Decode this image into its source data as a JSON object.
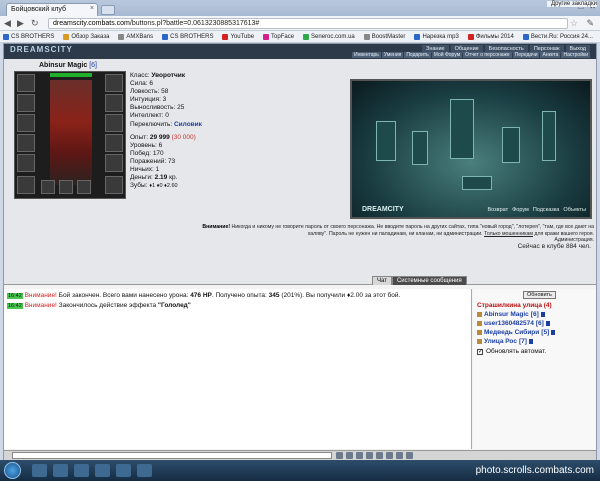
{
  "browser": {
    "tab_title": "Бойцовский клуб",
    "tab_close": "×",
    "url_host": "dreamscity.combats.com",
    "url_path": "/buttons.pl?battle=0.0613230885317613#",
    "back_glyph": "◀",
    "forward_glyph": "▶",
    "reload_glyph": "↻",
    "star_glyph": "☆",
    "menu_glyph": "✎",
    "window_controls": [
      "—",
      "□",
      "✕"
    ]
  },
  "bookmarks": [
    {
      "label": "CS BROTHERS",
      "color": "#2b66c8"
    },
    {
      "label": "Обзор Заказа",
      "color": "#d79b26"
    },
    {
      "label": "AMXBans",
      "color": "#888888"
    },
    {
      "label": "CS BROTHERS",
      "color": "#2b66c8"
    },
    {
      "label": "YouTube",
      "color": "#d32222"
    },
    {
      "label": "TopFace",
      "color": "#d3228d"
    },
    {
      "label": "Seneroc.com.ua",
      "color": "#2fa84a"
    },
    {
      "label": "BoostMaster",
      "color": "#888888"
    },
    {
      "label": "Нарезка mp3",
      "color": "#2b66c8"
    },
    {
      "label": "Фильмы 2014",
      "color": "#d32222"
    },
    {
      "label": "Вести.Ru: Россия 24...",
      "color": "#2b66c8"
    }
  ],
  "bookmarks_other": "Другие закладки",
  "game": {
    "logo": "DREAMSCITY",
    "top_nav": [
      "Знание",
      "Общение",
      "Безопасность",
      "Персонаж",
      "Выход"
    ],
    "sub_nav": [
      "Инвентарь",
      "Умения",
      "Подарить",
      "Мой Форум",
      "Отчет о персонаже",
      "Передачи",
      "Анкета",
      "Настройки"
    ],
    "character": {
      "name": "Abinsur Magic",
      "level": "[6]"
    },
    "stats": {
      "class_label": "Класс:",
      "class_value": "Уворотчик",
      "str": "Сила: 6",
      "agi": "Ловкость: 58",
      "int": "Интуиция: 3",
      "end": "Выносливость: 25",
      "intel": "Интеллект: 0",
      "switch_label": "Переключить:",
      "switch_value": "Силовик",
      "exp_label": "Опыт:",
      "exp_value": "29 999",
      "exp_next": "(30 000)",
      "level": "Уровень: 6",
      "wins": "Побед: 170",
      "losses": "Поражений: 73",
      "draws": "Ничьих: 1",
      "money_label": "Деньги:",
      "money_value": "2.19",
      "money_unit": "кр.",
      "teeth_label": "Зубы:",
      "teeth_value": "♦1 ♦0 ♦2.60"
    },
    "scene": {
      "logo": "DREAMCITY",
      "links": [
        "Возврат",
        "Форум",
        "Подсказка",
        "Объекты"
      ]
    },
    "warning": {
      "title": "Внимание!",
      "text": "Никогда и никому не говорите пароль от своего персонажа. Не вводите пароль на других сайтах, типа \"новый город\", \"лотерея\", \"там, где все дают на халяву\". Пароль не нужен ни паладинам, ни кланам, ни администрации.",
      "link": "Только мошенникам",
      "tail": "для кражи вашего героя.",
      "sign": "Администрация."
    },
    "online": "Сейчас в клубе 884 чел."
  },
  "chat": {
    "tabs": [
      "Чат",
      "Системные сообщения"
    ],
    "messages": [
      {
        "time": "16:42",
        "warn": "Внимание!",
        "pre": "Бой закончен. Всего вами нанесено урона:",
        "dmg": "476 HP",
        "mid": ". Получено опыта:",
        "exp": "345",
        "post": "(201%). Вы получили ♦2.00 за этот бой."
      },
      {
        "time": "16:42",
        "warn": "Внимание!",
        "pre": "Закончилось действие эффекта",
        "effect": "\"Гололед\""
      }
    ]
  },
  "side": {
    "refresh": "Обновить",
    "location": "Страшилкина улица (4)",
    "users": [
      {
        "name": "Abinsur Magic",
        "level": "[6]"
      },
      {
        "name": "user1360482574",
        "level": "[6]"
      },
      {
        "name": "Медведь Сибири",
        "level": "[5]"
      },
      {
        "name": "Улица Рос",
        "level": "[7]"
      }
    ],
    "auto_refresh": "Обновлять автомат."
  },
  "taskbar": {
    "watermark": "photo.scrolls.combats.com"
  }
}
